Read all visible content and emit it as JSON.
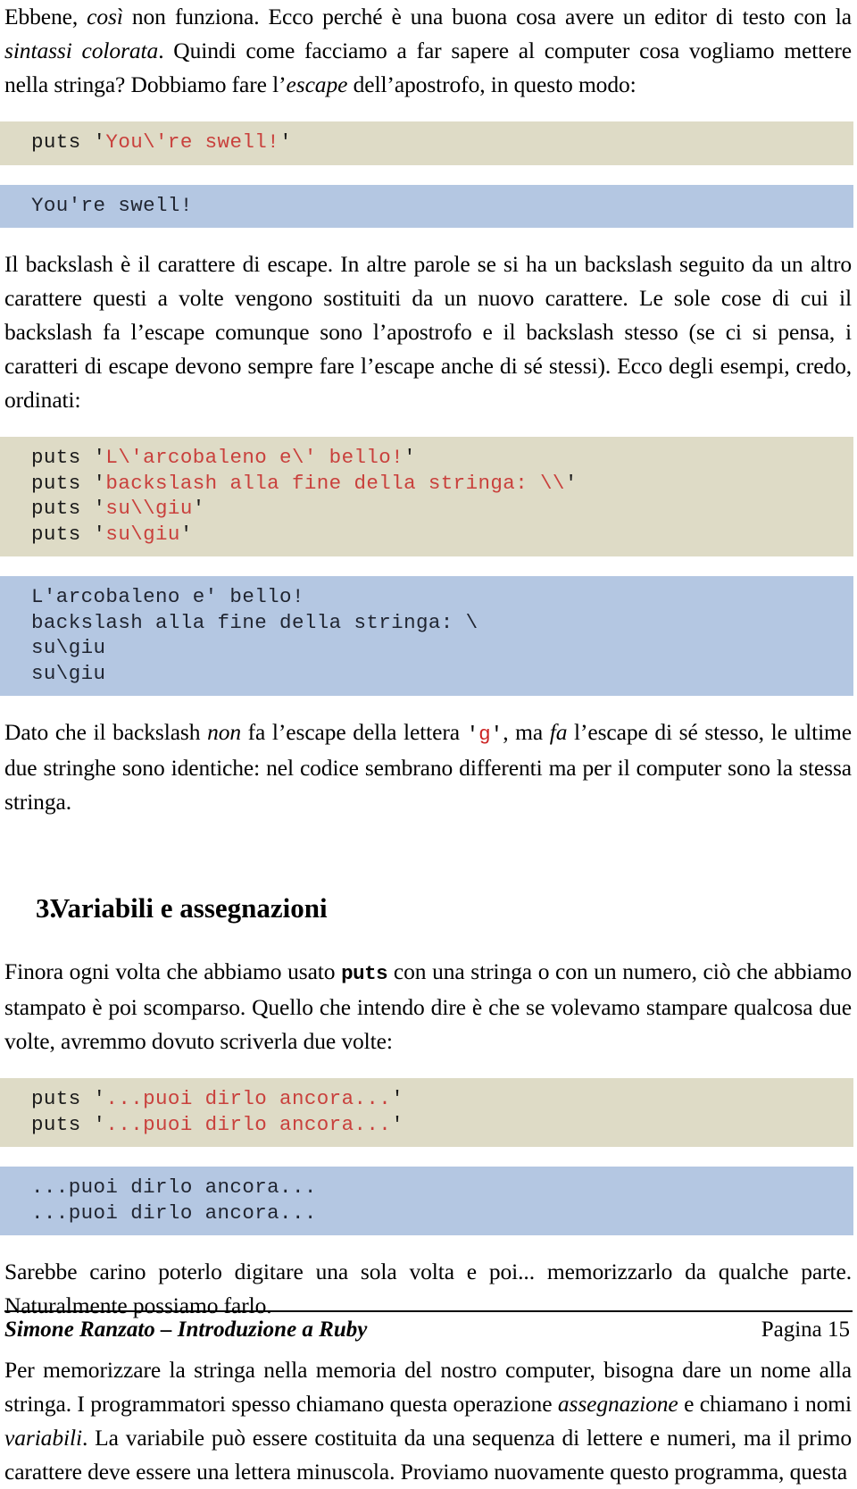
{
  "document": {
    "language": "it",
    "page_number_label": "Pagina 15",
    "footer_title": "Simone Ranzato – Introduzione a Ruby"
  },
  "colors": {
    "code_background": "#dedbc6",
    "output_background": "#b4c7e2",
    "string_red": "#c9403c",
    "text": "#000000"
  },
  "paragraphs": {
    "p1": {
      "part1": "Ebbene, ",
      "em1": "così",
      "part2": " non funziona. Ecco perché è una buona cosa avere un editor di testo con la ",
      "em2": "sintassi colorata",
      "part3": ". Quindi come facciamo a far sapere al computer cosa vogliamo mettere nella stringa? Dobbiamo fare l’",
      "em3": "escape",
      "part4": " dell’apostrofo, in questo modo:"
    },
    "p2": "Il backslash è il carattere di escape. In altre parole se si ha un backslash seguito da un altro carattere questi a volte vengono sostituiti da un nuovo carattere. Le sole cose di cui il backslash fa l’escape comunque sono l’apostrofo e il backslash stesso (se ci si pensa, i caratteri di escape devono sempre fare l’escape anche di sé stessi). Ecco degli esempi, credo, ordinati:",
    "p3": {
      "part1": "Dato che il backslash ",
      "em1": "non",
      "part2": " fa l’escape della lettera ",
      "code_quote_open": "'",
      "code_letter": "g",
      "code_quote_close": "'",
      "part3": ", ma ",
      "em2": "fa",
      "part4": " l’escape di sé stesso, le ultime due stringhe sono identiche: nel codice sembrano differenti ma per il computer sono la stessa stringa."
    },
    "p4": {
      "part1": "Finora ogni volta che abbiamo usato ",
      "code1": "puts",
      "part2": " con una stringa o con un numero, ciò che abbiamo stampato è poi scomparso. Quello che intendo dire è che se volevamo stampare qualcosa due volte, avremmo dovuto scriverla due volte:"
    },
    "p5": "Sarebbe carino poterlo digitare una sola volta e poi... memorizzarlo da qualche parte. Naturalmente possiamo farlo.",
    "p6": {
      "part1": "Per memorizzare la stringa nella memoria del nostro computer, bisogna dare un nome alla stringa. I programmatori spesso chiamano questa operazione ",
      "em1": "assegnazione",
      "part2": " e chiamano i nomi ",
      "em2": "variabili",
      "part3": ". La variabile può essere costituita da una sequenza di lettere e numeri, ma il primo carattere deve essere una lettera minuscola. Proviamo nuovamente questo programma, questa"
    }
  },
  "heading": {
    "number": "3.",
    "text": "Variabili e assegnazioni"
  },
  "code_blocks": {
    "block1": {
      "lines": [
        {
          "keyword": "puts ",
          "quote_open": "'",
          "string": "You\\'re swell!",
          "quote_close": "'"
        }
      ]
    },
    "block2": {
      "lines": [
        {
          "keyword": "puts ",
          "quote_open": "'",
          "string": "L\\'arcobaleno e\\' bello!",
          "quote_close": "'"
        },
        {
          "keyword": "puts ",
          "quote_open": "'",
          "string": "backslash alla fine della stringa: \\\\",
          "quote_close": "'"
        },
        {
          "keyword": "puts ",
          "quote_open": "'",
          "string": "su\\\\giu",
          "quote_close": "'"
        },
        {
          "keyword": "puts ",
          "quote_open": "'",
          "string": "su\\giu",
          "quote_close": "'"
        }
      ]
    },
    "block3": {
      "lines": [
        {
          "keyword": "puts ",
          "quote_open": "'",
          "string": "...puoi dirlo ancora...",
          "quote_close": "'"
        },
        {
          "keyword": "puts ",
          "quote_open": "'",
          "string": "...puoi dirlo ancora...",
          "quote_close": "'"
        }
      ]
    }
  },
  "output_blocks": {
    "out1": "You're swell!",
    "out2": "L'arcobaleno e' bello!\nbackslash alla fine della stringa: \\\nsu\\giu\nsu\\giu",
    "out3": "...puoi dirlo ancora...\n...puoi dirlo ancora..."
  }
}
